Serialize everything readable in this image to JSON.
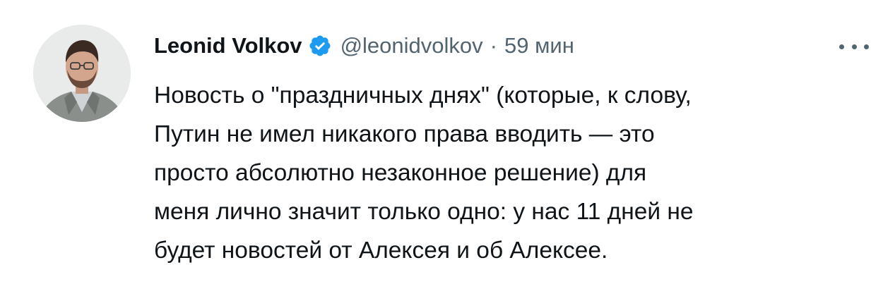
{
  "tweet": {
    "author": {
      "name": "Leonid Volkov",
      "handle": "@leonidvolkov",
      "verified": true,
      "avatar_icon": "avatar-photo"
    },
    "separator": "·",
    "timestamp": "59 мин",
    "more_icon": "more-horizontal-icon",
    "text_lines": [
      "Новость о \"праздничных днях\" (которые, к слову,",
      "Путин не имел никакого права вводить — это",
      "просто абсолютно незаконное решение) для",
      "меня лично значит только одно: у нас 11 дней не",
      "будет новостей от Алексея и об Алексее."
    ]
  },
  "colors": {
    "text_primary": "#0f1419",
    "text_secondary": "#536471",
    "verified_badge": "#1d9bf0",
    "background": "#ffffff"
  }
}
